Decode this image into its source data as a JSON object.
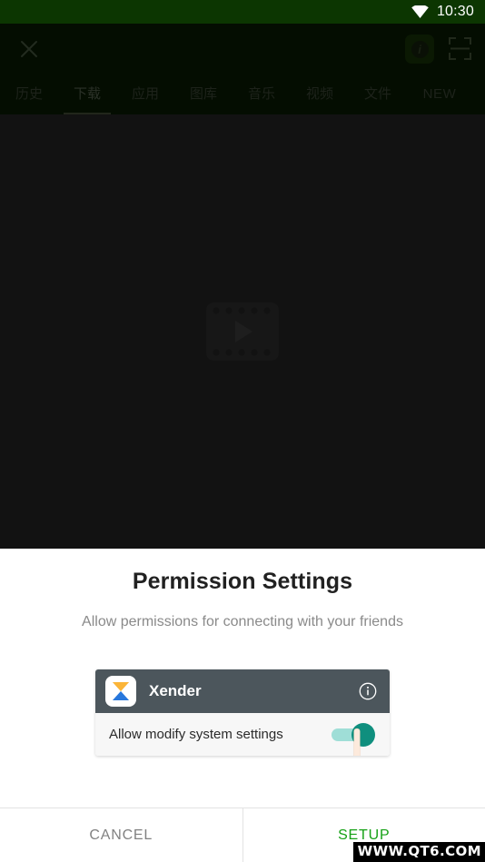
{
  "statusbar": {
    "time": "10:30",
    "wifi_icon": "wifi-icon",
    "background_color": "#0c3601"
  },
  "toolbar": {
    "close_icon": "close-icon",
    "info_icon": "info-icon",
    "scan_icon": "scan-icon",
    "info_glyph": "i"
  },
  "tabs": [
    {
      "label": "历史",
      "active": false
    },
    {
      "label": "下载",
      "active": true
    },
    {
      "label": "应用",
      "active": false
    },
    {
      "label": "图库",
      "active": false
    },
    {
      "label": "音乐",
      "active": false
    },
    {
      "label": "视频",
      "active": false
    },
    {
      "label": "文件",
      "active": false
    },
    {
      "label": "NEW",
      "active": false
    }
  ],
  "content": {
    "placeholder_icon": "video-placeholder-icon",
    "background_color": "#1f1f1f"
  },
  "dialog": {
    "title": "Permission Settings",
    "subtitle": "Allow permissions for connecting with your friends",
    "card": {
      "app_name": "Xender",
      "app_icon": "xender-hourglass-icon",
      "info_icon": "info-circle-icon",
      "header_color": "#4c565c",
      "permission_label": "Allow modify system settings",
      "toggle_state": "on",
      "toggle_color": "#0f8f7e",
      "hand_cursor_icon": "hand-pointer-icon"
    },
    "buttons": {
      "cancel": "CANCEL",
      "setup": "SETUP",
      "cancel_color": "#818181",
      "setup_color": "#16a116"
    }
  },
  "watermark": {
    "text": "WWW.QT6.COM"
  }
}
